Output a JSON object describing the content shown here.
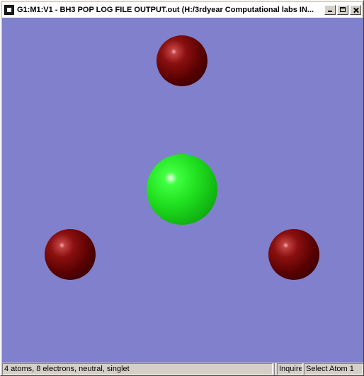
{
  "window": {
    "title": "G1:M1:V1 - BH3 POP LOG FILE OUTPUT.out (H:/3rdyear Computational labs IN...",
    "icon": "gaussview-app-icon"
  },
  "title_buttons": [
    "minimize",
    "maximize",
    "close"
  ],
  "viewport": {
    "background": "#8080cc",
    "molecule": {
      "atoms": [
        {
          "element": "H",
          "color": "#8a1010"
        },
        {
          "element": "B",
          "color": "#20e020"
        },
        {
          "element": "H",
          "color": "#8a1010"
        },
        {
          "element": "H",
          "color": "#8a1010"
        }
      ]
    }
  },
  "status": {
    "info": "4 atoms, 8 electrons, neutral, singlet",
    "mode": "Inquire",
    "action": "Select Atom 1"
  }
}
